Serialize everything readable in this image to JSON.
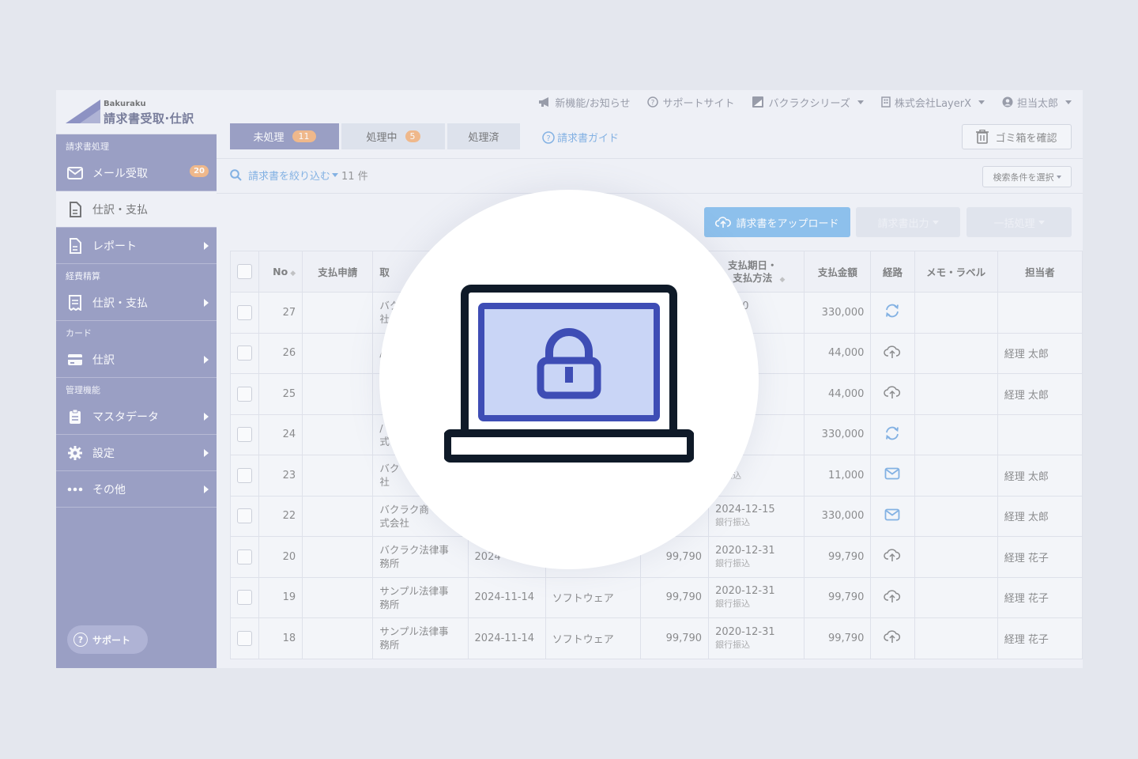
{
  "logo": {
    "small": "Bakuraku",
    "big": "請求書受取·仕訳"
  },
  "topbar": {
    "news": "新機能/お知らせ",
    "support_site": "サポートサイト",
    "series": "バクラクシリーズ",
    "company": "株式会社LayerX",
    "user": "担当太郎"
  },
  "sidebar": {
    "sections": [
      {
        "label": "請求書処理"
      },
      {
        "label": "経費精算"
      },
      {
        "label": "カード"
      },
      {
        "label": "管理機能"
      }
    ],
    "items": [
      {
        "label": "メール受取",
        "badge": "20",
        "icon": "mail-icon"
      },
      {
        "label": "仕訳・支払",
        "icon": "document-icon"
      },
      {
        "label": "レポート",
        "icon": "report-icon"
      },
      {
        "label": "仕訳・支払",
        "icon": "receipt-icon"
      },
      {
        "label": "仕訳",
        "icon": "card-icon"
      },
      {
        "label": "マスタデータ",
        "icon": "clipboard-icon"
      },
      {
        "label": "設定",
        "icon": "gear-icon"
      },
      {
        "label": "その他",
        "icon": "more-icon"
      }
    ],
    "support_label": "サポート"
  },
  "tabs": [
    {
      "label": "未処理",
      "count": "11"
    },
    {
      "label": "処理中",
      "count": "5"
    },
    {
      "label": "処理済"
    }
  ],
  "guide_label": "請求書ガイド",
  "trash_label": "ゴミ箱を確認",
  "filter": {
    "label": "請求書を絞り込む",
    "count": "11 件"
  },
  "condition_label": "検索条件を選択",
  "actions": {
    "upload": "請求書をアップロード",
    "export": "請求書出力",
    "bulk": "一括処理"
  },
  "table": {
    "headers": {
      "no": "No",
      "apply": "支払申請",
      "partner": "取",
      "due_1": "支払期日・",
      "due_2": "支払方法",
      "amount": "支払金額",
      "route": "経路",
      "memo": "メモ・ラベル",
      "owner": "担当者"
    },
    "rows": [
      {
        "no": "27",
        "partner": "バク",
        "partner2": "社",
        "date": "",
        "category": "",
        "amount_pre": "",
        "due": "-06-30",
        "method": "込",
        "amount": "330,000",
        "route": "sync-icon",
        "owner": ""
      },
      {
        "no": "26",
        "partner": "/",
        "partner2": "",
        "date": "",
        "category": "",
        "amount_pre": "",
        "due": "4-15",
        "method": "",
        "amount": "44,000",
        "route": "upload-icon",
        "owner": "経理 太郎"
      },
      {
        "no": "25",
        "partner": "",
        "partner2": "",
        "date": "",
        "category": "",
        "amount_pre": "",
        "due": "4-15",
        "method": "",
        "amount": "44,000",
        "route": "upload-icon",
        "owner": "経理 太郎"
      },
      {
        "no": "24",
        "partner": "/",
        "partner2": "式",
        "date": "",
        "category": "",
        "amount_pre": "",
        "due": "05-31",
        "method": "込",
        "amount": "330,000",
        "route": "sync-icon",
        "owner": ""
      },
      {
        "no": "23",
        "partner": "バク",
        "partner2": "社",
        "date": "",
        "category": "",
        "amount_pre": "",
        "due": "",
        "method": "行振込",
        "amount": "11,000",
        "route": "mail-icon",
        "owner": "経理 太郎"
      },
      {
        "no": "22",
        "partner": "バクラク商",
        "partner2": "式会社",
        "date": "",
        "category": "",
        "amount_pre": "",
        "due": "2024-12-15",
        "method": "銀行振込",
        "amount": "330,000",
        "route": "mail-icon",
        "owner": "経理 太郎"
      },
      {
        "no": "20",
        "partner": "バクラク法律事",
        "partner2": "務所",
        "date": "2024",
        "category": "",
        "amount_pre": "99,790",
        "due": "2020-12-31",
        "method": "銀行振込",
        "amount": "99,790",
        "route": "upload-icon",
        "owner": "経理 花子"
      },
      {
        "no": "19",
        "partner": "サンプル法律事",
        "partner2": "務所",
        "date": "2024-11-14",
        "category": "ソフトウェア",
        "amount_pre": "99,790",
        "due": "2020-12-31",
        "method": "銀行振込",
        "amount": "99,790",
        "route": "upload-icon",
        "owner": "経理 花子"
      },
      {
        "no": "18",
        "partner": "サンプル法律事",
        "partner2": "務所",
        "date": "2024-11-14",
        "category": "ソフトウェア",
        "amount_pre": "99,790",
        "due": "2020-12-31",
        "method": "銀行振込",
        "amount": "99,790",
        "route": "upload-icon",
        "owner": "経理 花子"
      }
    ]
  },
  "overlay_icon": "laptop-lock-icon",
  "colors": {
    "sidebar": "#6e73aa",
    "accent": "#4a90d9",
    "badge": "#f09a52",
    "upload": "#5aa6e6",
    "lock": "#3e4db5"
  }
}
